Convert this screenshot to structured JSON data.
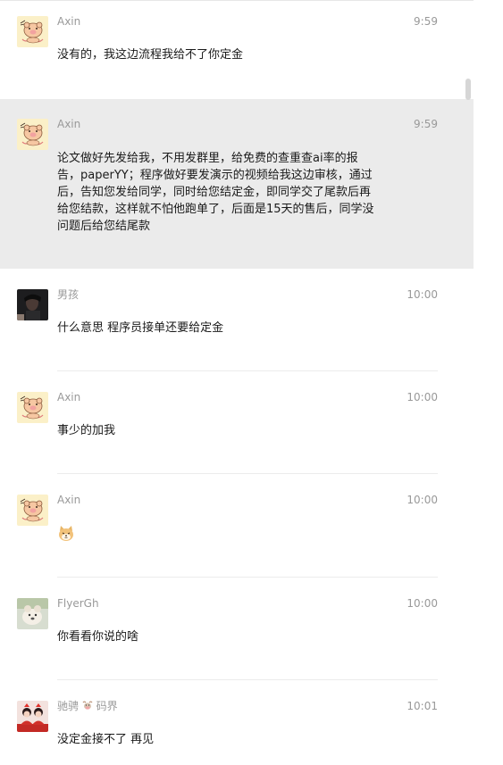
{
  "messages": [
    {
      "sender": "Axin",
      "time": "9:59",
      "text": "没有的，我这边流程我给不了你定金",
      "avatar": "pig-avatar"
    },
    {
      "sender": "Axin",
      "time": "9:59",
      "text": "论文做好先发给我，不用发群里，给免费的查重查ai率的报告，paperYY；程序做好要发演示的视频给我这边审核，通过后，告知您发给同学，同时给您结定金，即同学交了尾款后再给您结款，这样就不怕他跑单了，后面是15天的售后，同学没问题后给您结尾款",
      "avatar": "pig-avatar"
    },
    {
      "sender": "男孩",
      "time": "10:00",
      "text": "什么意思  程序员接单还要给定金",
      "avatar": "dark-portrait-avatar"
    },
    {
      "sender": "Axin",
      "time": "10:00",
      "text": "事少的加我",
      "avatar": "pig-avatar"
    },
    {
      "sender": "Axin",
      "time": "10:00",
      "text": "",
      "emoji": "doge-emoji",
      "avatar": "pig-avatar"
    },
    {
      "sender": "FlyerGh",
      "time": "10:00",
      "text": "你看看你说的啥",
      "avatar": "dog-photo-avatar"
    },
    {
      "sender": "驰骋",
      "sender_suffix": "码界",
      "time": "10:01",
      "text": "没定金接不了  再见",
      "avatar": "red-figures-avatar"
    }
  ]
}
